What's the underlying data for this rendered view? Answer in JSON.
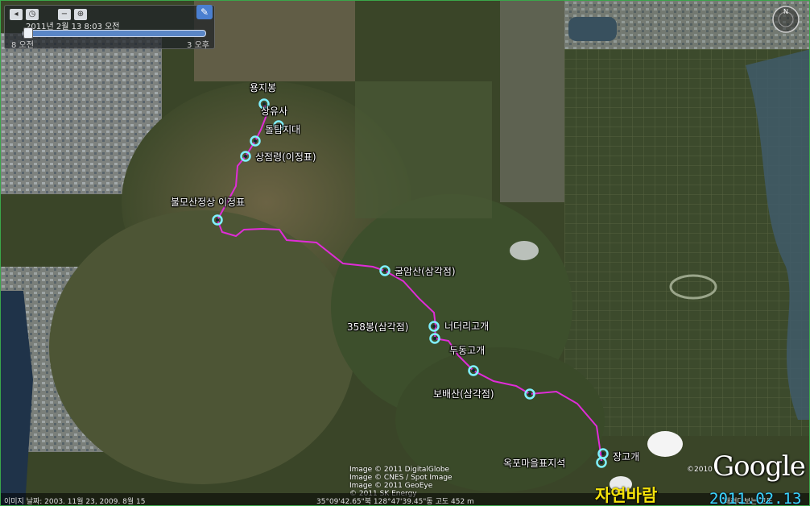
{
  "timeslider": {
    "date": "2011년 2월  13   8:03 오전",
    "start_label": "8 오전",
    "end_label": "3 오후",
    "buttons": [
      "◂",
      "◷",
      "−",
      "⊕"
    ],
    "wrench_icon": "wrench-icon"
  },
  "compass": {
    "north": "N"
  },
  "route": {
    "color": "#e02cd8",
    "waypoints": [
      {
        "label": "용지봉",
        "anchor": "center-above"
      },
      {
        "label": "상유사",
        "anchor": "right"
      },
      {
        "label": "돌탑지대",
        "anchor": "right"
      },
      {
        "label": "상점령(이정표)",
        "anchor": "right"
      },
      {
        "label": "불모산정상 이정표",
        "anchor": "above"
      },
      {
        "label": "굴암산(삼각점)",
        "anchor": "right"
      },
      {
        "label": "358봉(삼각점)",
        "anchor": "left"
      },
      {
        "label": "너더리고개",
        "anchor": "right"
      },
      {
        "label": "두동고개",
        "anchor": "above"
      },
      {
        "label": "보배산(삼각점)",
        "anchor": "left"
      },
      {
        "label": "장고개",
        "anchor": "right"
      },
      {
        "label": "옥포마을표지석",
        "anchor": "left"
      }
    ]
  },
  "attribution": {
    "lines": [
      "Image © 2011 DigitalGlobe",
      "Image © CNES / Spot Image",
      "Image © 2011 GeoEye",
      "© 2011 SK Energy"
    ]
  },
  "status_bar": {
    "imagery_date": "이미지 날짜: 2003. 11월 23, 2009. 8월 15",
    "coords": "35°09'42.65\"북   128°47'39.45\"동  고도  452 m",
    "streaming": "내려다보는 고도"
  },
  "branding": {
    "logo": "Google",
    "year": "©2010"
  },
  "overlay": {
    "watermark": "자연바람",
    "date_stamp": "2011.02.13"
  },
  "colors": {
    "waypoint_ring": "#7ff0ff",
    "route_line": "#e02cd8",
    "watermark": "#f4e20b",
    "date_stamp": "#3ad7ff"
  }
}
